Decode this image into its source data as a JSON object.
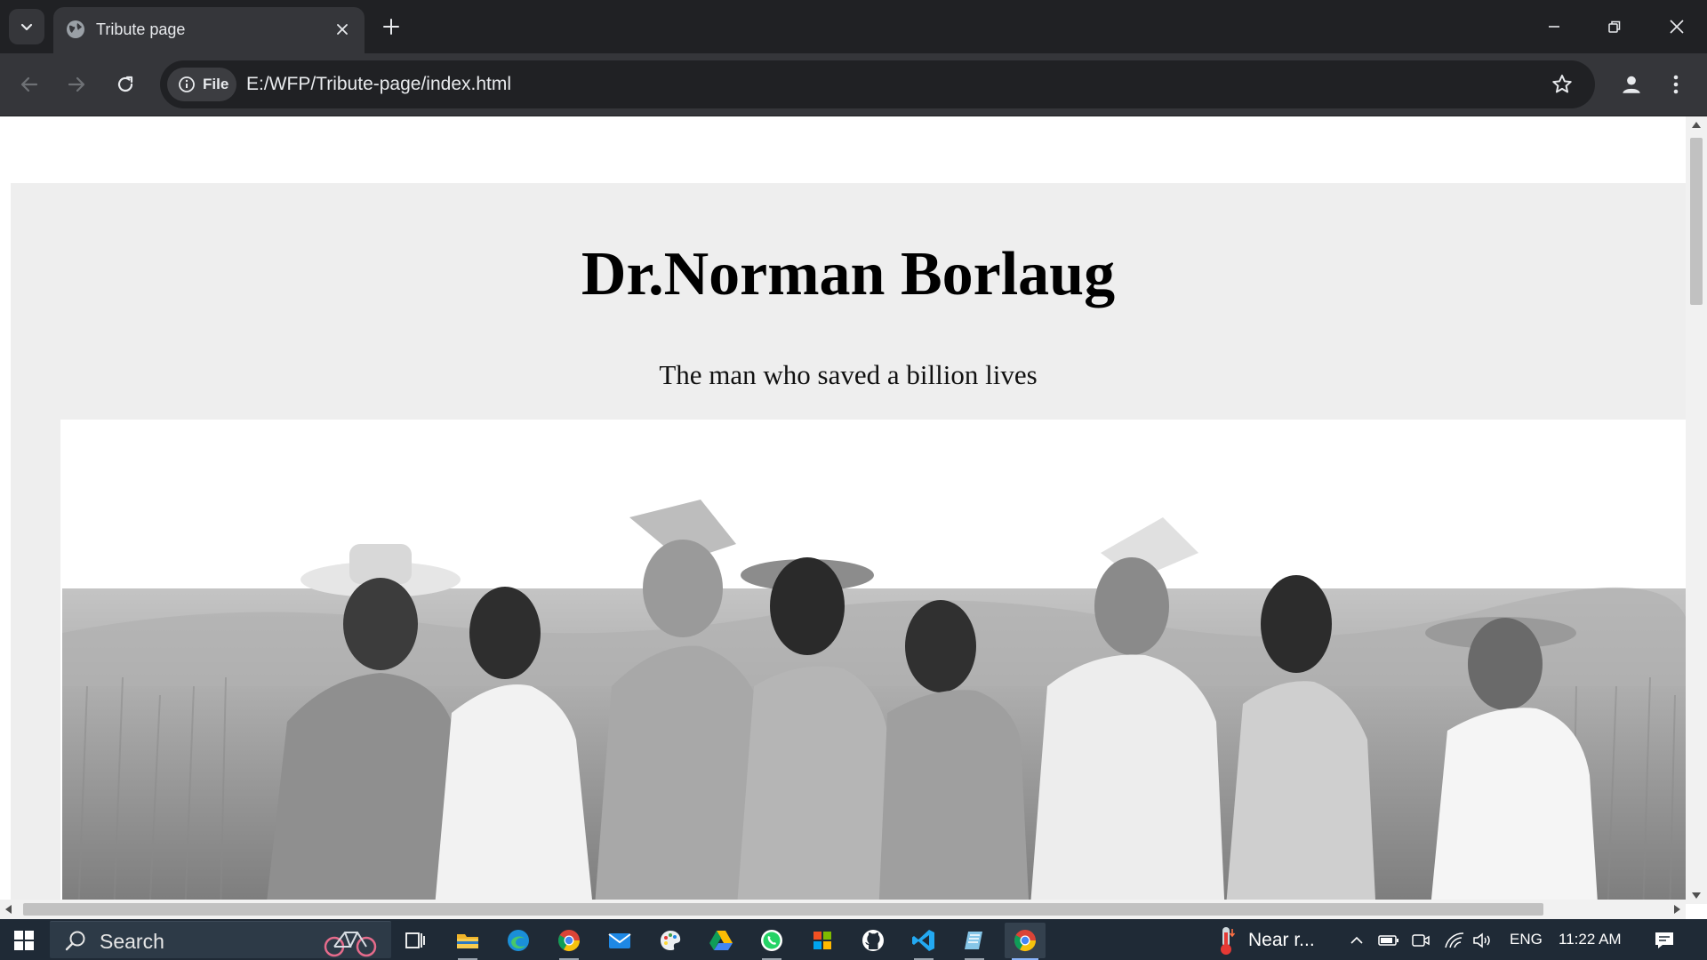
{
  "browser": {
    "tab_title": "Tribute page",
    "url": "E:/WFP/Tribute-page/index.html",
    "security_chip": "File"
  },
  "page": {
    "title": "Dr.Norman Borlaug",
    "tagline": "The man who saved a billion lives"
  },
  "taskbar": {
    "search_placeholder": "Search",
    "weather_text": "Near r...",
    "language": "ENG",
    "time": "11:22 AM",
    "pinned_apps": [
      "task-view",
      "file-explorer",
      "edge",
      "chrome",
      "mail",
      "paint",
      "google-drive",
      "whatsapp",
      "windows-store",
      "github",
      "vscode",
      "notepad",
      "chrome-active"
    ]
  },
  "colors": {
    "tab_strip": "#202124",
    "toolbar": "#35363a",
    "page_background": "#eeeeee",
    "taskbar": "#1f2a36"
  }
}
